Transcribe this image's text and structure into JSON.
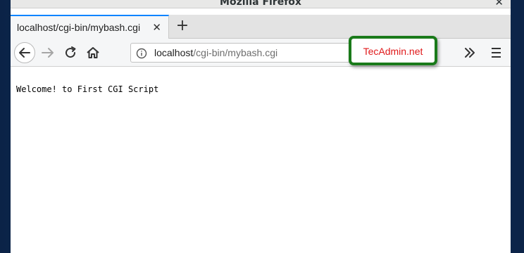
{
  "window": {
    "title": "Mozilla Firefox"
  },
  "tabs": [
    {
      "label": "localhost/cgi-bin/mybash.cgi"
    }
  ],
  "urlbar": {
    "host": "localhost",
    "path": "/cgi-bin/mybash.cgi"
  },
  "page": {
    "body_text": "Welcome! to First CGI Script"
  },
  "watermark": {
    "text": "TecAdmin.net"
  },
  "colors": {
    "active_tab_accent": "#0a84ff",
    "badge_border": "#1a7a1a",
    "badge_text": "#e0191a",
    "desktop_bg": "#0d2a52"
  },
  "icons": {
    "back": "arrow-left-icon",
    "forward": "arrow-right-icon",
    "reload": "reload-icon",
    "home": "home-icon",
    "site_info": "info-icon",
    "overflow": "double-chevron-right-icon",
    "menu": "hamburger-menu-icon",
    "new_tab": "plus-icon",
    "close": "close-icon"
  }
}
